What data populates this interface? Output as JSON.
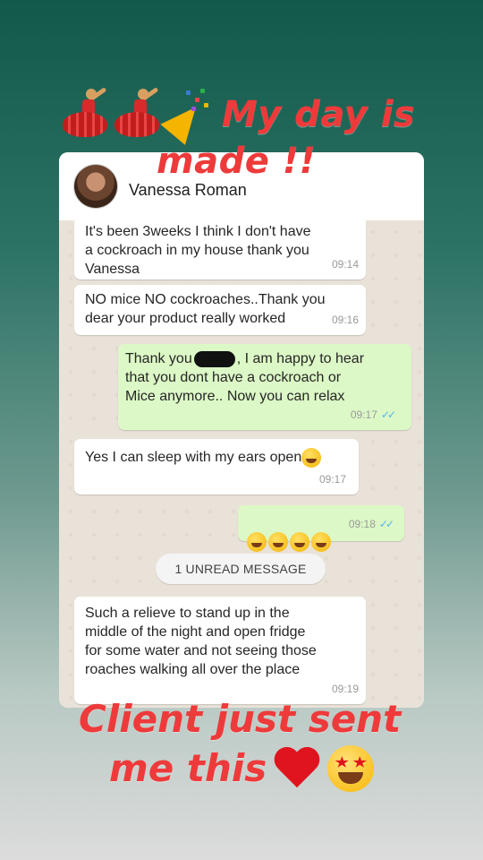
{
  "overlay": {
    "top_line1": "My day is",
    "top_line2": "made !!",
    "bottom_line1": "Client just sent",
    "bottom_line2": "me this",
    "top_emojis": [
      "woman-dancing-icon",
      "woman-dancing-icon",
      "party-popper-icon"
    ],
    "bottom_emojis": [
      "red-heart-icon",
      "heart-eyes-face-icon"
    ],
    "text_color": "#ee3a3a"
  },
  "chat": {
    "contact_name": "Vanessa Roman",
    "unread_label": "1 UNREAD MESSAGE",
    "messages": [
      {
        "direction": "in",
        "text": "It's been 3weeks I think I don't have\na cockroach in my house thank you\nVanessa",
        "time": "09:14"
      },
      {
        "direction": "in",
        "text": "NO mice NO cockroaches..Thank you\ndear your product really worked",
        "time": "09:16"
      },
      {
        "direction": "out",
        "text_before": "Thank you",
        "text_after": ", I am happy to hear\nthat you dont have a cockroach or\nMice anymore.. Now you can relax",
        "time": "09:17",
        "ticks": "✓✓"
      },
      {
        "direction": "in",
        "text": "Yes I can sleep with my ears open",
        "time": "09:17"
      },
      {
        "direction": "out",
        "emojis": [
          "rolling-laughing-icon",
          "tears-of-joy-icon",
          "rolling-laughing-icon",
          "hugging-face-icon"
        ],
        "time": "09:18",
        "ticks": "✓✓"
      },
      {
        "direction": "in",
        "text": "Such a relieve to stand up in the\nmiddle of the night and open fridge\nfor some water and not seeing those\nroaches walking all over the place",
        "time": "09:19"
      }
    ],
    "colors": {
      "incoming_bubble": "#ffffff",
      "outgoing_bubble": "#dcf8c6",
      "read_ticks": "#4fb6ec",
      "chat_background": "#e9e2d8"
    }
  }
}
